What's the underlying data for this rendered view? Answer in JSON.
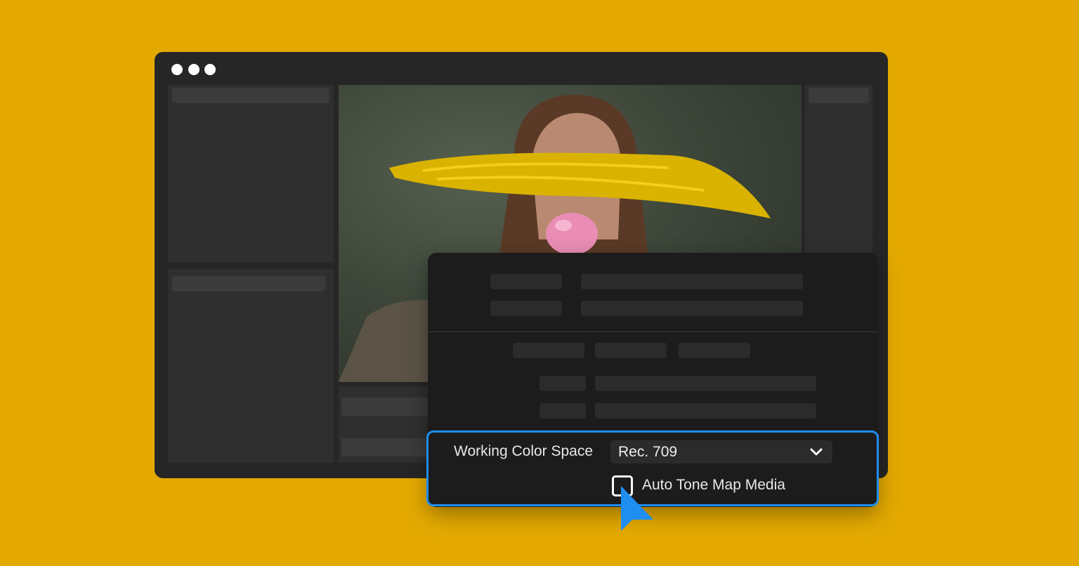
{
  "colors": {
    "background": "#e3a902",
    "window": "#262626",
    "dialog": "#1c1c1c",
    "accent": "#1f8ef1"
  },
  "window": {
    "controls": [
      "dot",
      "dot",
      "dot"
    ]
  },
  "viewer": {
    "image_subject": "woman-blowing-pink-bubblegum-with-yellow-paint-stroke"
  },
  "settings": {
    "working_color_space_label": "Working Color Space",
    "working_color_space_value": "Rec. 709",
    "auto_tone_map_label": "Auto Tone Map Media",
    "auto_tone_map_checked": false
  },
  "icons": {
    "dropdown": "chevron-down-icon",
    "pointer": "cursor-arrow-icon"
  }
}
